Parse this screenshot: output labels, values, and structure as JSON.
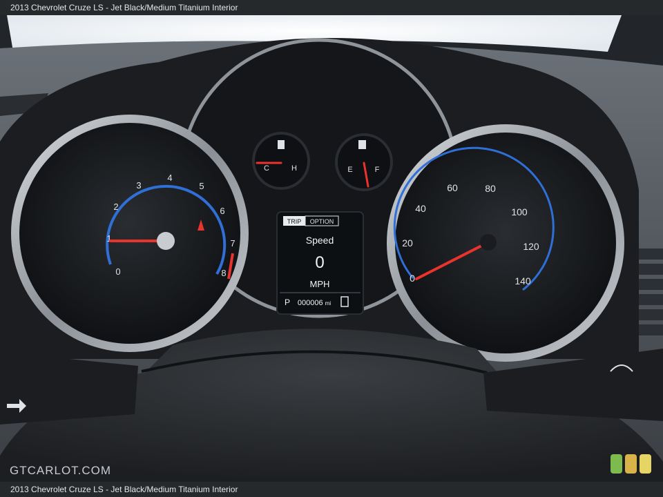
{
  "caption": {
    "top": "2013 Chevrolet Cruze LS - Jet Black/Medium Titanium Interior",
    "bottom": "2013 Chevrolet Cruze LS - Jet Black/Medium Titanium Interior"
  },
  "watermark": "GTCARLOT.COM",
  "tachometer": {
    "ticks": [
      "0",
      "1",
      "2",
      "3",
      "4",
      "5",
      "6",
      "7",
      "8"
    ],
    "needle_value": 0.5
  },
  "speedometer": {
    "ticks": [
      "0",
      "20",
      "40",
      "60",
      "80",
      "100",
      "120",
      "140"
    ],
    "unit": "MPH",
    "needle_value": 0
  },
  "temp_gauge": {
    "low": "C",
    "high": "H"
  },
  "fuel_gauge": {
    "low": "E",
    "high": "F"
  },
  "dic": {
    "tabs": [
      "TRIP",
      "OPTION"
    ],
    "label": "Speed",
    "value": "0",
    "unit": "MPH",
    "gear": "P",
    "odometer": "000006",
    "odometer_unit": "mi"
  },
  "colors": {
    "accent_blue": "#2f6fd6",
    "needle_red": "#e8342c",
    "dash_dark": "#1c1e21",
    "dic_screen": "#0d1013",
    "badge_green": "#7dbb4e",
    "badge_amber": "#d9b24a",
    "badge_yellow": "#e6d465"
  }
}
